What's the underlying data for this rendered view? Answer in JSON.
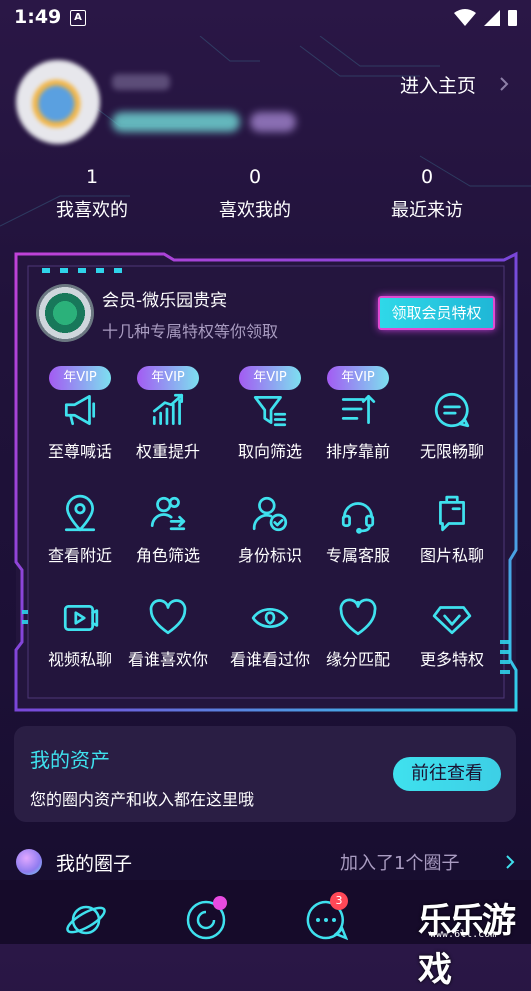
{
  "status_bar": {
    "time": "1:49",
    "notification_icon": "A"
  },
  "profile": {
    "homepage_link": "进入主页"
  },
  "stats": [
    {
      "value": "1",
      "label": "我喜欢的"
    },
    {
      "value": "0",
      "label": "喜欢我的"
    },
    {
      "value": "0",
      "label": "最近来访"
    }
  ],
  "vip": {
    "title": "会员-微乐园贵宾",
    "subtitle": "十几种专属特权等你领取",
    "claim_button": "领取会员特权",
    "badge_text": "年VIP",
    "features": [
      {
        "label": "至尊喊话",
        "icon": "megaphone-icon",
        "badge": true
      },
      {
        "label": "权重提升",
        "icon": "chart-up-icon",
        "badge": true
      },
      {
        "label": "取向筛选",
        "icon": "filter-icon",
        "badge": true
      },
      {
        "label": "排序靠前",
        "icon": "sort-up-icon",
        "badge": true
      },
      {
        "label": "无限畅聊",
        "icon": "chat-bubble-icon",
        "badge": false
      },
      {
        "label": "查看附近",
        "icon": "location-pin-icon",
        "badge": false
      },
      {
        "label": "角色筛选",
        "icon": "users-switch-icon",
        "badge": false
      },
      {
        "label": "身份标识",
        "icon": "user-verified-icon",
        "badge": false
      },
      {
        "label": "专属客服",
        "icon": "headset-icon",
        "badge": false
      },
      {
        "label": "图片私聊",
        "icon": "image-chat-icon",
        "badge": false
      },
      {
        "label": "视频私聊",
        "icon": "video-icon",
        "badge": false
      },
      {
        "label": "看谁喜欢你",
        "icon": "heart-icon",
        "badge": false
      },
      {
        "label": "看谁看过你",
        "icon": "eye-icon",
        "badge": false
      },
      {
        "label": "缘分匹配",
        "icon": "heart-match-icon",
        "badge": false
      },
      {
        "label": "更多特权",
        "icon": "diamond-icon",
        "badge": false
      }
    ]
  },
  "assets": {
    "title": "我的资产",
    "description": "您的圈内资产和收入都在这里哦",
    "button": "前往查看"
  },
  "circle": {
    "label": "我的圈子",
    "info": "加入了1个圈子"
  },
  "bottom_nav": {
    "message_badge": "3"
  },
  "watermark": {
    "text": "乐乐游戏",
    "url": "www.6ll.com"
  },
  "colors": {
    "accent": "#3fe1ee",
    "magenta": "#e04bd1",
    "background": "#20123a"
  }
}
